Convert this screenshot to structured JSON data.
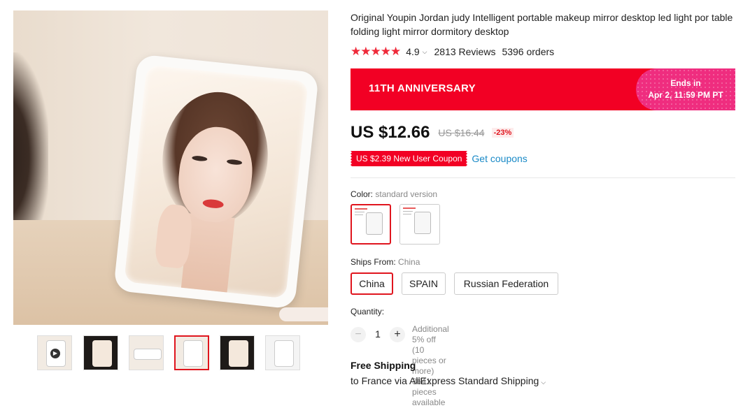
{
  "product": {
    "title": "Original Youpin Jordan judy Intelligent portable makeup mirror desktop led light por table folding light mirror dormitory desktop",
    "rating": "4.9",
    "reviews": "2813 Reviews",
    "orders": "5396 orders",
    "stars_filled": 5
  },
  "promo": {
    "title": "11TH ANNIVERSARY",
    "ends_label": "Ends in",
    "ends_time": "Apr 2, 11:59 PM PT"
  },
  "price": {
    "current": "US $12.66",
    "original": "US $16.44",
    "discount": "-23%"
  },
  "coupon": {
    "label": "US $2.39 New User Coupon",
    "link": "Get coupons"
  },
  "color": {
    "label": "Color:",
    "selected": "standard version"
  },
  "ships_from": {
    "label": "Ships From:",
    "selected": "China",
    "options": [
      "China",
      "SPAIN",
      "Russian Federation"
    ]
  },
  "quantity": {
    "label": "Quantity:",
    "value": "1",
    "minus": "−",
    "plus": "+",
    "note_1": "Additional 5% off (10 pieces or more)",
    "note_2": "3641 pieces available"
  },
  "shipping": {
    "title": "Free Shipping",
    "method": "to France via AliExpress Standard Shipping"
  },
  "colors": {
    "accent": "#e0151e",
    "banner": "#f20024",
    "banner_ends": "#ef2d7f",
    "link": "#1a8ac7"
  }
}
